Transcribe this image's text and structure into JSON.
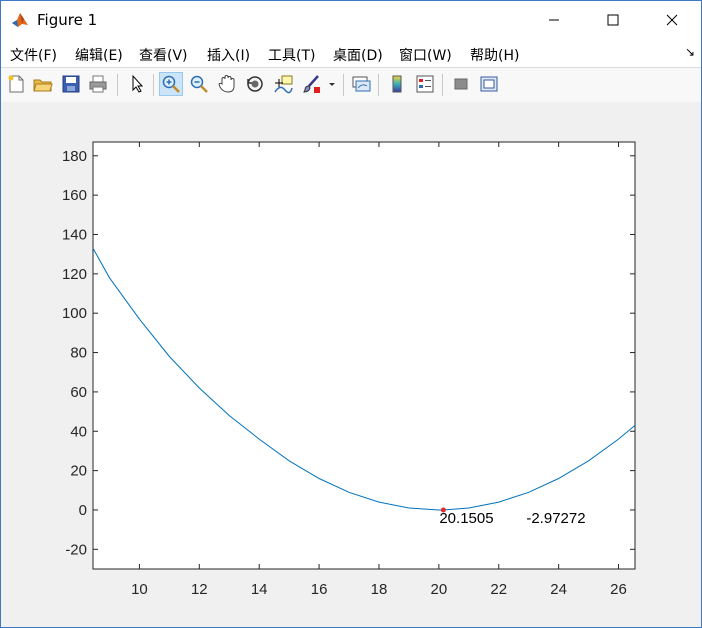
{
  "window": {
    "title": "Figure 1",
    "controls": [
      "minimize",
      "maximize",
      "close"
    ]
  },
  "menu": {
    "items": [
      "文件(F)",
      "编辑(E)",
      "查看(V)",
      "插入(I)",
      "工具(T)",
      "桌面(D)",
      "窗口(W)",
      "帮助(H)"
    ],
    "overflow_glyph": "↘"
  },
  "toolbar": {
    "buttons": [
      "new-figure-icon",
      "open-folder-icon",
      "save-icon",
      "print-icon",
      "pointer-icon",
      "zoom-in-icon",
      "zoom-out-icon",
      "pan-hand-icon",
      "rotate-3d-icon",
      "data-cursor-icon",
      "brush-icon",
      "brush-dropdown-icon",
      "link-plot-icon",
      "colorbar-icon",
      "legend-icon",
      "hide-plot-tools-icon",
      "show-plot-tools-icon"
    ],
    "active": "zoom-in-icon"
  },
  "chart_data": {
    "type": "line",
    "xlim": [
      8.45,
      26.55
    ],
    "ylim": [
      -30,
      187
    ],
    "xticks": [
      10,
      12,
      14,
      16,
      18,
      20,
      22,
      24,
      26
    ],
    "yticks": [
      -20,
      0,
      20,
      40,
      60,
      80,
      100,
      120,
      140,
      160,
      180
    ],
    "grid": false,
    "line_color": "#0072bd",
    "series": [
      {
        "x": [
          8.45,
          9,
          10,
          11,
          12,
          13,
          14,
          15,
          16,
          17,
          18,
          19,
          20,
          20.15,
          21,
          22,
          23,
          24,
          25,
          26,
          26.55
        ],
        "y": [
          133,
          118,
          97,
          78,
          62,
          48,
          36,
          25,
          16,
          9,
          4,
          1,
          0,
          0,
          1,
          4,
          9,
          16,
          25,
          36,
          43
        ]
      }
    ],
    "datatip": {
      "x_label": "20.1505",
      "y_label": "-2.97272",
      "x": 20.15,
      "y": 0,
      "marker_color": "#e32a2a"
    }
  }
}
